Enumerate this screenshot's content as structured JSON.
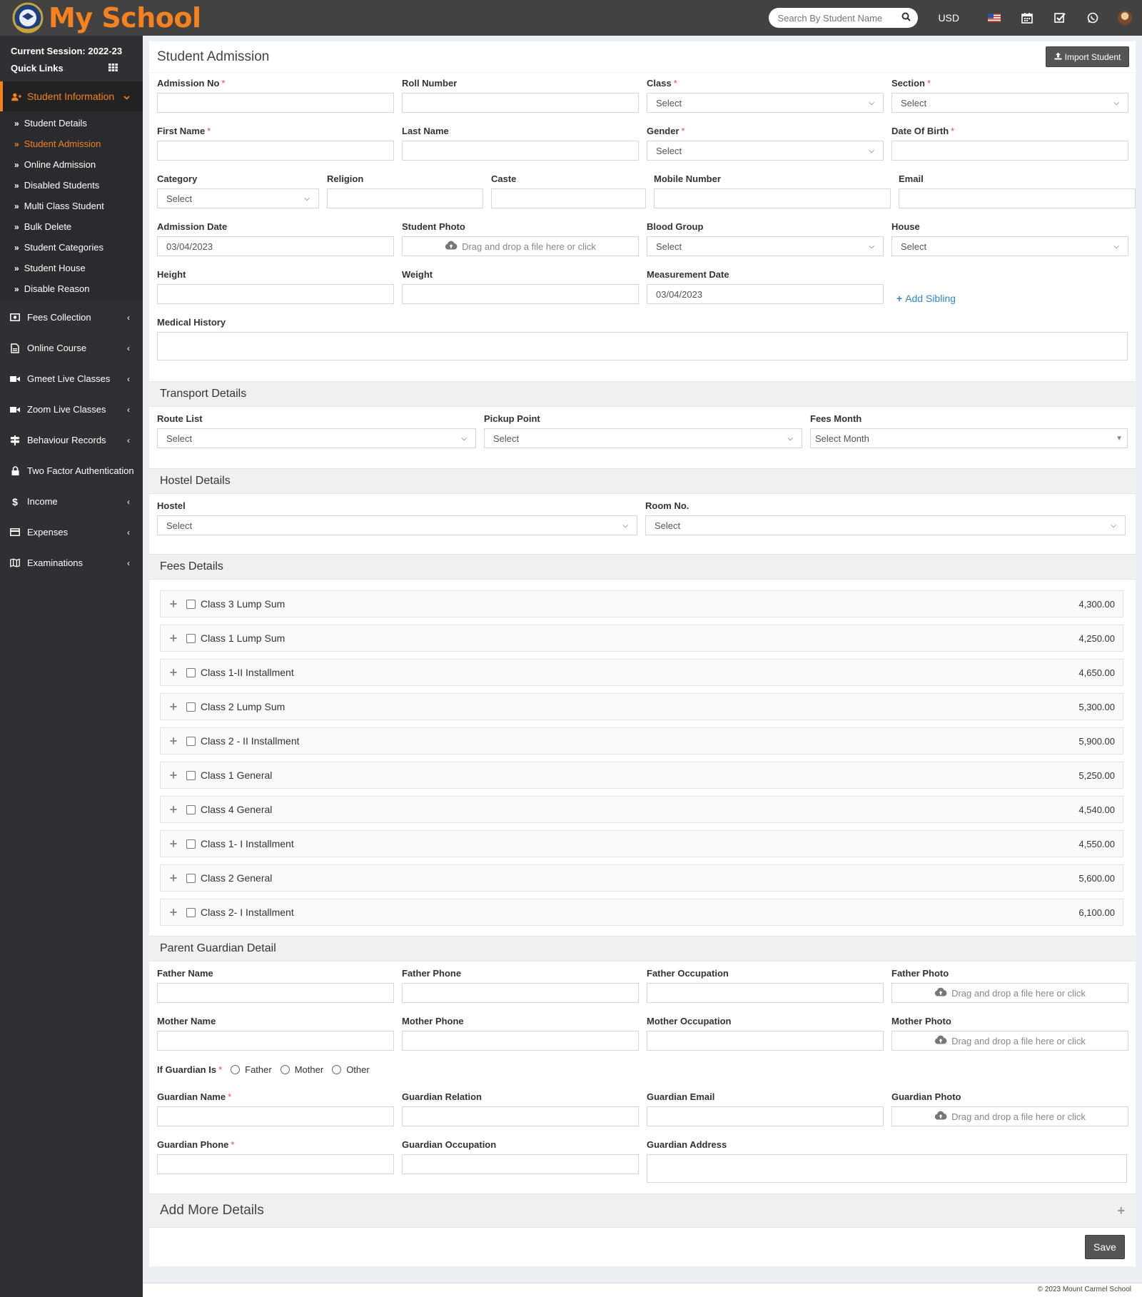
{
  "app": {
    "name": "My School"
  },
  "header": {
    "search_placeholder": "Search By Student Name",
    "currency": "USD",
    "icons": [
      "us-flag-icon",
      "calendar-icon",
      "task-check-icon",
      "whatsapp-icon",
      "user-avatar"
    ]
  },
  "sidebar": {
    "session": "Current Session: 2022-23",
    "quick_links": "Quick Links",
    "active_menu": "Student Information",
    "submenu": [
      "Student Details",
      "Student Admission",
      "Online Admission",
      "Disabled Students",
      "Multi Class Student",
      "Bulk Delete",
      "Student Categories",
      "Student House",
      "Disable Reason"
    ],
    "active_submenu": "Student Admission",
    "menu": [
      "Fees Collection",
      "Online Course",
      "Gmeet Live Classes",
      "Zoom Live Classes",
      "Behaviour Records",
      "Two Factor Authentication",
      "Income",
      "Expenses",
      "Examinations"
    ]
  },
  "page": {
    "title": "Student Admission",
    "import_label": "Import Student"
  },
  "form": {
    "admission_no": "Admission No",
    "roll_number": "Roll Number",
    "class": "Class",
    "section": "Section",
    "first_name": "First Name",
    "last_name": "Last Name",
    "gender": "Gender",
    "dob": "Date Of Birth",
    "category": "Category",
    "religion": "Religion",
    "caste": "Caste",
    "mobile": "Mobile Number",
    "email": "Email",
    "admission_date": "Admission Date",
    "admission_date_value": "03/04/2023",
    "student_photo": "Student Photo",
    "blood_group": "Blood Group",
    "house": "House",
    "height": "Height",
    "weight": "Weight",
    "measurement_date": "Measurement Date",
    "measurement_date_value": "03/04/2023",
    "add_sibling": "Add Sibling",
    "medical_history": "Medical History",
    "select": "Select",
    "drop_text": "Drag and drop a file here or click"
  },
  "transport": {
    "title": "Transport Details",
    "route_list": "Route List",
    "pickup_point": "Pickup Point",
    "fees_month": "Fees Month",
    "select_month": "Select Month"
  },
  "hostel": {
    "title": "Hostel Details",
    "hostel": "Hostel",
    "room_no": "Room No."
  },
  "fees": {
    "title": "Fees Details",
    "items": [
      {
        "name": "Class 3 Lump Sum",
        "amount": "4,300.00"
      },
      {
        "name": "Class 1 Lump Sum",
        "amount": "4,250.00"
      },
      {
        "name": "Class 1-II Installment",
        "amount": "4,650.00"
      },
      {
        "name": "Class 2 Lump Sum",
        "amount": "5,300.00"
      },
      {
        "name": "Class 2 - II Installment",
        "amount": "5,900.00"
      },
      {
        "name": "Class 1 General",
        "amount": "5,250.00"
      },
      {
        "name": "Class 4 General",
        "amount": "4,540.00"
      },
      {
        "name": "Class 1- I Installment",
        "amount": "4,550.00"
      },
      {
        "name": "Class 2 General",
        "amount": "5,600.00"
      },
      {
        "name": "Class 2- I Installment",
        "amount": "6,100.00"
      }
    ]
  },
  "parent": {
    "title": "Parent Guardian Detail",
    "father_name": "Father Name",
    "father_phone": "Father Phone",
    "father_occupation": "Father Occupation",
    "father_photo": "Father Photo",
    "mother_name": "Mother Name",
    "mother_phone": "Mother Phone",
    "mother_occupation": "Mother Occupation",
    "mother_photo": "Mother Photo",
    "guardian_is": "If Guardian Is",
    "opt_father": "Father",
    "opt_mother": "Mother",
    "opt_other": "Other",
    "guardian_name": "Guardian Name",
    "guardian_relation": "Guardian Relation",
    "guardian_email": "Guardian Email",
    "guardian_photo": "Guardian Photo",
    "guardian_phone": "Guardian Phone",
    "guardian_occupation": "Guardian Occupation",
    "guardian_address": "Guardian Address"
  },
  "more": {
    "title": "Add More Details"
  },
  "actions": {
    "save": "Save"
  },
  "footer": {
    "text": "© 2023 Mount Carmel School"
  },
  "colors": {
    "brand": "#f5821f",
    "sidebar": "#2f3033",
    "topbar": "#424242",
    "link": "#2d87c8"
  }
}
